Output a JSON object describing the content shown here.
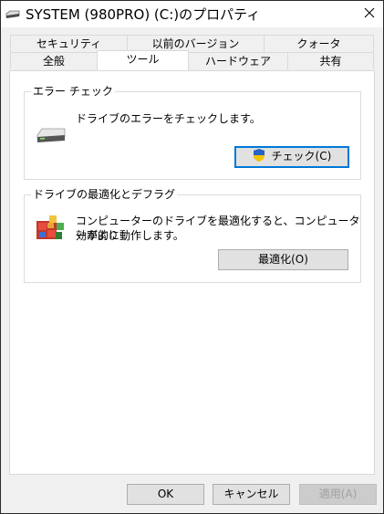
{
  "window": {
    "title": "SYSTEM (980PRO) (C:)のプロパティ"
  },
  "tabs": {
    "row_top": [
      "セキュリティ",
      "以前のバージョン",
      "クォータ"
    ],
    "row_bottom": [
      "全般",
      "ツール",
      "ハードウェア",
      "共有"
    ],
    "selected": "ツール"
  },
  "error_check": {
    "group_title": "エラー チェック",
    "description": "ドライブのエラーをチェックします。",
    "button_label": "チェック(C)"
  },
  "optimize": {
    "group_title": "ドライブの最適化とデフラグ",
    "description_line1": "コンピューターのドライブを最適化すると、コンピューターがより",
    "description_line2": "効率的に動作します。",
    "button_label": "最適化(O)"
  },
  "footer": {
    "ok_label": "OK",
    "cancel_label": "キャンセル",
    "apply_label": "適用(A)"
  },
  "icons": {
    "title": "drive-icon",
    "close": "close-icon",
    "error_check": "hard-drive-icon",
    "shield": "uac-shield-icon",
    "optimize": "defrag-icon"
  },
  "colors": {
    "default_button_border": "#0078d7",
    "panel_background": "#ffffff",
    "window_background": "#f0f0f0"
  }
}
